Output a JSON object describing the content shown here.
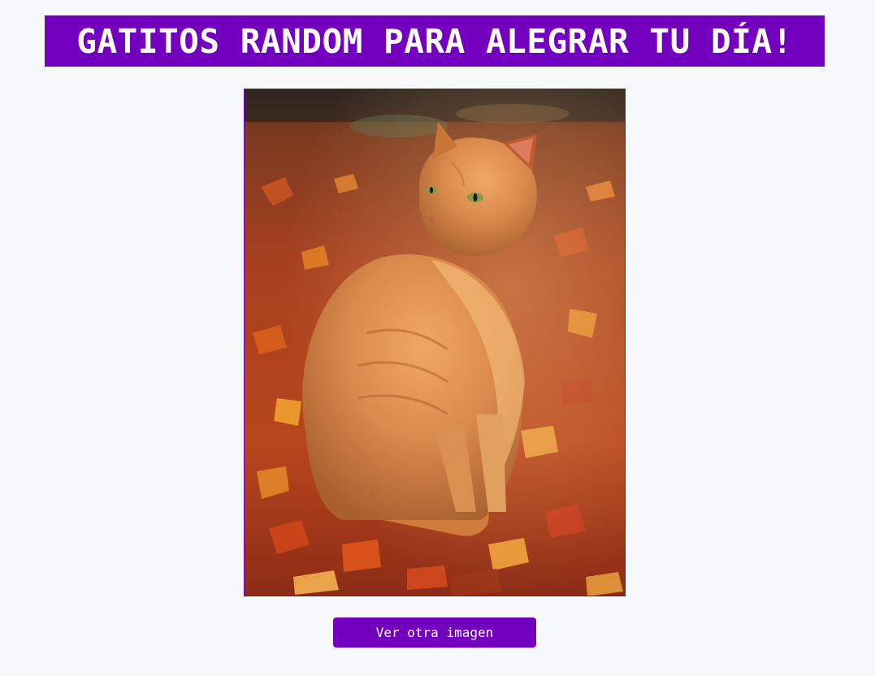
{
  "header": {
    "title": "GATITOS RANDOM PARA ALEGRAR TU DÍA!"
  },
  "photo": {
    "subject": "orange cat sitting on autumn leaves"
  },
  "actions": {
    "next_label": "Ver otra imagen"
  },
  "colors": {
    "accent": "#7300bf",
    "background": "#f7f8fa",
    "button_text": "#ffffff"
  }
}
